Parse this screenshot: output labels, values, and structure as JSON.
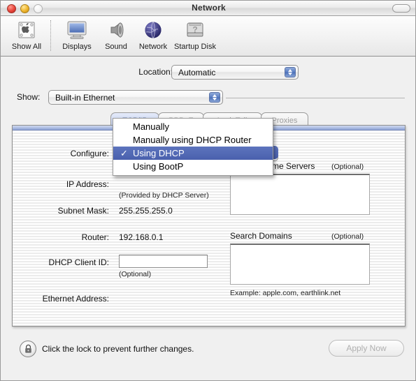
{
  "window": {
    "title": "Network",
    "controls": {
      "close": "close-button",
      "minimize": "minimize-button",
      "zoom": "zoom-button",
      "toolbar_toggle": "toolbar-toggle-pill"
    }
  },
  "toolbar": {
    "items": [
      {
        "label": "Show All",
        "icon": "show-all-icon"
      },
      {
        "label": "Displays",
        "icon": "displays-icon"
      },
      {
        "label": "Sound",
        "icon": "sound-icon"
      },
      {
        "label": "Network",
        "icon": "network-globe-icon"
      },
      {
        "label": "Startup Disk",
        "icon": "startup-disk-icon"
      }
    ]
  },
  "location": {
    "label": "Location:",
    "value": "Automatic"
  },
  "show": {
    "label": "Show:",
    "value": "Built-in Ethernet"
  },
  "tabs": [
    {
      "label": "TCP/IP",
      "active": true
    },
    {
      "label": "PPPoE",
      "active": false
    },
    {
      "label": "AppleTalk",
      "active": false
    },
    {
      "label": "Proxies",
      "active": false
    }
  ],
  "tcpip": {
    "configure_label": "Configure:",
    "configure_value": "Using DHCP",
    "ip_address_label": "IP Address:",
    "ip_address_value": "",
    "ip_address_hint": "(Provided by DHCP Server)",
    "subnet_mask_label": "Subnet Mask:",
    "subnet_mask_value": "255.255.255.0",
    "router_label": "Router:",
    "router_value": "192.168.0.1",
    "dhcp_client_id_label": "DHCP Client ID:",
    "dhcp_client_id_value": "",
    "dhcp_client_id_hint": "(Optional)",
    "ethernet_address_label": "Ethernet Address:",
    "ethernet_address_value": "",
    "dns_title": "Domain Name Servers",
    "dns_optional": "(Optional)",
    "dns_value": "",
    "search_domains_title": "Search Domains",
    "search_domains_optional": "(Optional)",
    "search_domains_value": "",
    "search_domains_example": "Example: apple.com, earthlink.net"
  },
  "configure_menu": {
    "items": [
      {
        "label": "Manually",
        "checked": false
      },
      {
        "label": "Manually using DHCP Router",
        "checked": false
      },
      {
        "label": "Using DHCP",
        "checked": true
      },
      {
        "label": "Using BootP",
        "checked": false
      }
    ],
    "check_glyph": "✓"
  },
  "bottom": {
    "lock_icon": "lock-closed-icon",
    "lock_text": "Click the lock to prevent further changes.",
    "apply_label": "Apply Now",
    "apply_enabled": false
  },
  "colors": {
    "accent_blue": "#4a60ad",
    "selection_blue": "#5d74bd",
    "panel_band": "#8b9fd0",
    "close_red": "#e8443a",
    "minimize_yellow": "#eeb42a",
    "disabled_text": "#b0b0b0"
  }
}
